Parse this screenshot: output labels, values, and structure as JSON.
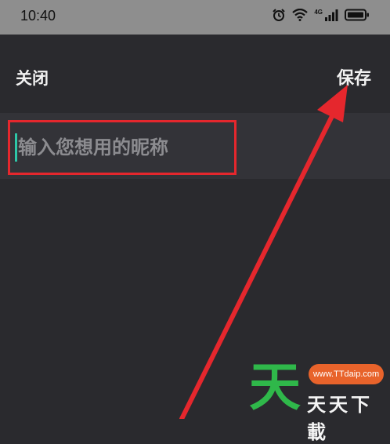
{
  "status_bar": {
    "time": "10:40",
    "network_label": "4G",
    "icons": [
      "alarm-icon",
      "wifi-icon",
      "cellular-signal-icon",
      "battery-icon"
    ]
  },
  "header": {
    "close_label": "关闭",
    "save_label": "保存"
  },
  "nickname_field": {
    "placeholder": "输入您想用的昵称",
    "value": ""
  },
  "watermark": {
    "big_char": "天",
    "url": "www.TTdaip.com",
    "small_text": "天天下載"
  },
  "colors": {
    "status_bar_bg": "#8e8e8e",
    "app_bg": "#2a2a2e",
    "input_row_bg": "#333338",
    "highlight_red": "#e5272d",
    "cursor_teal": "#2ec7a8",
    "watermark_green": "#2fb84a",
    "watermark_orange": "#e8632b"
  }
}
